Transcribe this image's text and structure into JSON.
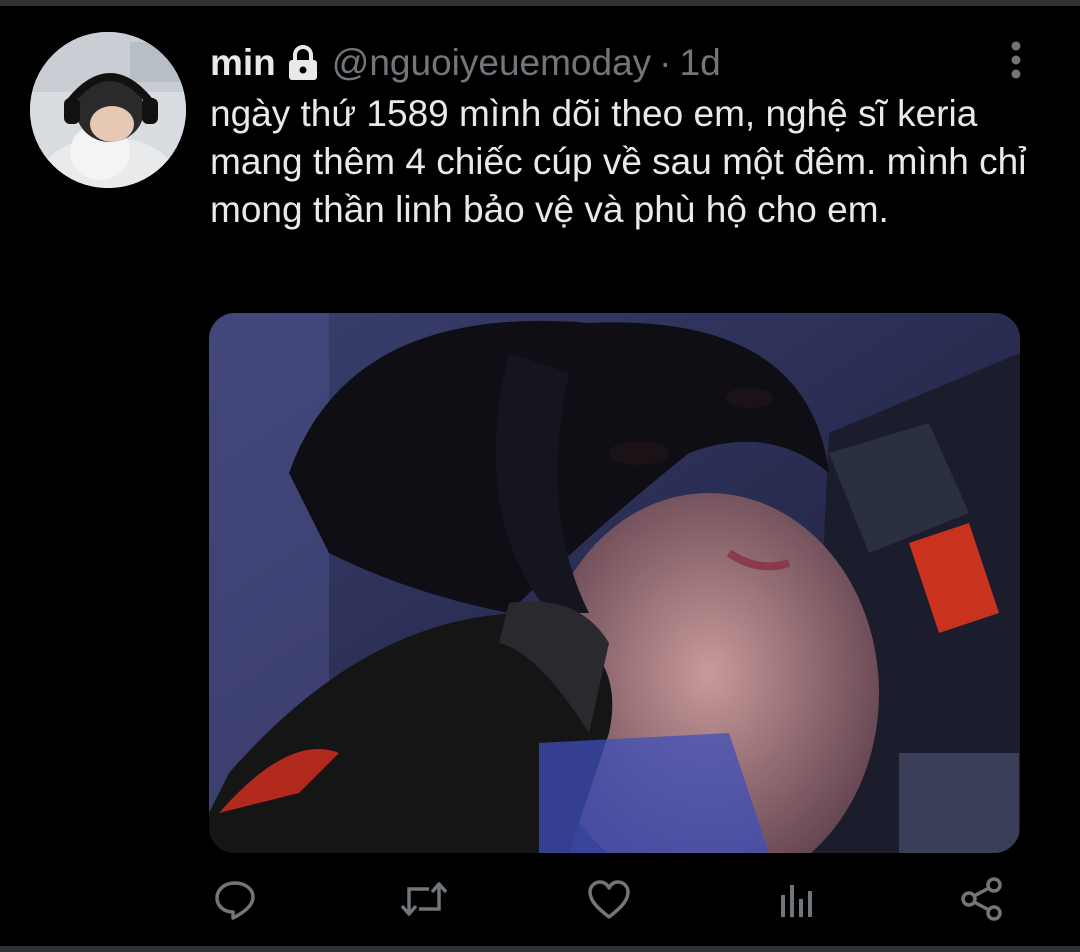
{
  "tweet": {
    "display_name": "min",
    "protected_icon": "lock-icon",
    "handle": "@nguoiyeuemoday",
    "separator": "·",
    "time": "1d",
    "text": "ngày thứ 1589 mình dõi theo em, nghệ sĩ keria mang thêm 4 chiếc cúp về sau một đêm. mình chỉ mong thần linh bảo vệ và phù hộ cho em."
  },
  "icons": {
    "more": "more-vertical-icon",
    "reply": "reply-icon",
    "retweet": "retweet-icon",
    "like": "heart-icon",
    "analytics": "analytics-icon",
    "share": "share-icon"
  },
  "colors": {
    "background": "#000000",
    "text": "#e7e9ea",
    "secondary": "#71767b"
  }
}
